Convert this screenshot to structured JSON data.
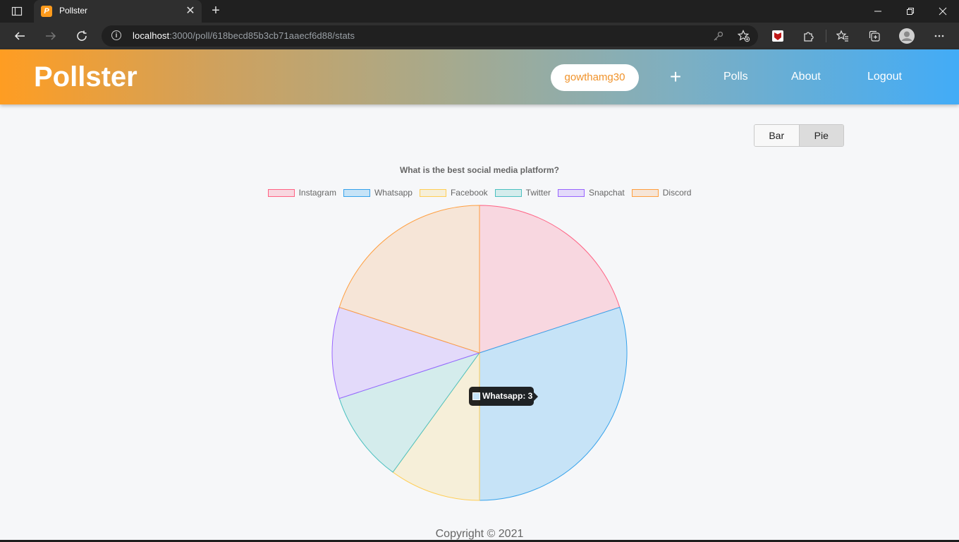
{
  "browser": {
    "tab_title": "Pollster",
    "favicon_letter": "P",
    "url_host": "localhost",
    "url_rest": ":3000/poll/618becd85b3cb71aaecf6d88/stats"
  },
  "header": {
    "brand": "Pollster",
    "username": "gowthamg30",
    "plus": "+",
    "nav": {
      "polls": "Polls",
      "about": "About",
      "logout": "Logout"
    }
  },
  "toggle": {
    "bar": "Bar",
    "pie": "Pie",
    "selected": "Pie"
  },
  "tooltip": {
    "text": "Whatsapp: 3",
    "color": "#c6e3f7"
  },
  "footer": "Copyright © 2021",
  "colors": {
    "accent_orange": "#f0932b",
    "header_gradient_start": "#ff9d22",
    "header_gradient_end": "#42acf7"
  },
  "chart_data": {
    "type": "pie",
    "title": "What is the best social media platform?",
    "legend_position": "top",
    "categories": [
      "Instagram",
      "Whatsapp",
      "Facebook",
      "Twitter",
      "Snapchat",
      "Discord"
    ],
    "values": [
      2,
      3,
      1,
      1,
      1,
      2
    ],
    "fill_colors": [
      "#f8d7e0",
      "#c6e3f7",
      "#f6efd9",
      "#d4ecec",
      "#e3dafa",
      "#f6e5d7"
    ],
    "border_colors": [
      "#ff6384",
      "#36a2eb",
      "#ffce56",
      "#4bc0c0",
      "#9966ff",
      "#ff9f40"
    ]
  }
}
